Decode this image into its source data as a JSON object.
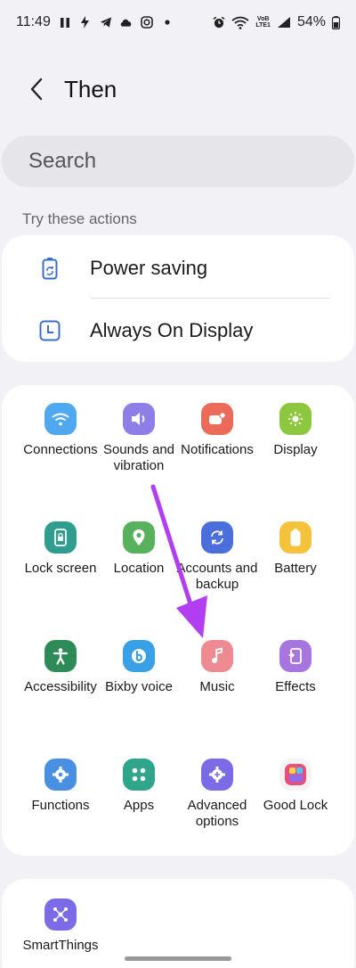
{
  "status": {
    "time": "11:49",
    "network_top": "VoB",
    "network_bottom": "LTE1",
    "battery": "54%"
  },
  "header": {
    "title": "Then"
  },
  "search": {
    "placeholder": "Search"
  },
  "suggestions": {
    "label": "Try these actions",
    "items": [
      {
        "label": "Power saving",
        "icon": "battery-recycle-icon"
      },
      {
        "label": "Always On Display",
        "icon": "clock-icon"
      }
    ]
  },
  "apps": [
    {
      "label": "Connections",
      "icon": "wifi-icon",
      "color": "#4fa8f0"
    },
    {
      "label": "Sounds and vibration",
      "icon": "volume-icon",
      "color": "#8d7ee8"
    },
    {
      "label": "Notifications",
      "icon": "notification-icon",
      "color": "#ec6a5a"
    },
    {
      "label": "Display",
      "icon": "sun-icon",
      "color": "#8dc73f"
    },
    {
      "label": "Lock screen",
      "icon": "lock-icon",
      "color": "#2f9e8e"
    },
    {
      "label": "Location",
      "icon": "location-pin-icon",
      "color": "#58b15c"
    },
    {
      "label": "Accounts and backup",
      "icon": "sync-icon",
      "color": "#4a6fdc"
    },
    {
      "label": "Battery",
      "icon": "battery-icon",
      "color": "#f5c33b"
    },
    {
      "label": "Accessibility",
      "icon": "accessibility-icon",
      "color": "#2e8b57"
    },
    {
      "label": "Bixby voice",
      "icon": "bixby-icon",
      "color": "#3aa0e6"
    },
    {
      "label": "Music",
      "icon": "music-note-icon",
      "color": "#ee8a92"
    },
    {
      "label": "Effects",
      "icon": "effects-icon",
      "color": "#a774e0"
    },
    {
      "label": "Functions",
      "icon": "gear-icon",
      "color": "#4a90e2"
    },
    {
      "label": "Apps",
      "icon": "apps-grid-icon",
      "color": "#2fa58a"
    },
    {
      "label": "Advanced options",
      "icon": "advanced-gear-icon",
      "color": "#7b6be6"
    },
    {
      "label": "Good Lock",
      "icon": "good-lock-icon",
      "color": "#f4f4f4"
    }
  ],
  "more": {
    "label": "SmartThings",
    "icon": "smartthings-icon",
    "color": "#7b6be6"
  },
  "annotation": {
    "arrow_color": "#b23ef2"
  }
}
